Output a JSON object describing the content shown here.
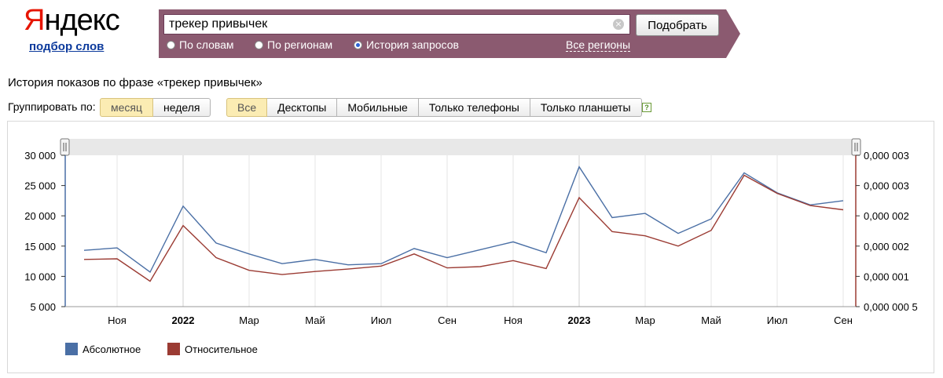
{
  "logo": {
    "text_first": "Я",
    "text_rest": "ндекс",
    "subtitle": "подбор слов"
  },
  "search": {
    "value": "трекер привычек",
    "clear_icon": "close-circle-icon",
    "submit_label": "Подобрать",
    "options": [
      {
        "label": "По словам",
        "selected": false
      },
      {
        "label": "По регионам",
        "selected": false
      },
      {
        "label": "История запросов",
        "selected": true
      }
    ],
    "regions_label": "Все регионы",
    "bar_color": "#8b5a70"
  },
  "page": {
    "title": "История показов по фразе «трекер привычек»",
    "group_label": "Группировать по:",
    "group_options": [
      {
        "label": "месяц",
        "active": true
      },
      {
        "label": "неделя",
        "active": false
      }
    ],
    "device_options": [
      {
        "label": "Все",
        "active": true
      },
      {
        "label": "Десктопы",
        "active": false
      },
      {
        "label": "Мобильные",
        "active": false
      },
      {
        "label": "Только телефоны",
        "active": false
      },
      {
        "label": "Только планшеты",
        "active": false
      }
    ],
    "help_icon": "question-icon"
  },
  "chart_data": {
    "type": "line",
    "title": "",
    "x": [
      "2021-10",
      "2021-11",
      "2021-12",
      "2022-01",
      "2022-02",
      "2022-03",
      "2022-04",
      "2022-05",
      "2022-06",
      "2022-07",
      "2022-08",
      "2022-09",
      "2022-10",
      "2022-11",
      "2022-12",
      "2023-01",
      "2023-02",
      "2023-03",
      "2023-04",
      "2023-05",
      "2023-06",
      "2023-07",
      "2023-08",
      "2023-09"
    ],
    "x_tick_labels": [
      {
        "month": "2021-11",
        "label": "Ноя",
        "bold": false
      },
      {
        "month": "2022-01",
        "label": "2022",
        "bold": true
      },
      {
        "month": "2022-03",
        "label": "Мар",
        "bold": false
      },
      {
        "month": "2022-05",
        "label": "Май",
        "bold": false
      },
      {
        "month": "2022-07",
        "label": "Июл",
        "bold": false
      },
      {
        "month": "2022-09",
        "label": "Сен",
        "bold": false
      },
      {
        "month": "2022-11",
        "label": "Ноя",
        "bold": false
      },
      {
        "month": "2023-01",
        "label": "2023",
        "bold": true
      },
      {
        "month": "2023-03",
        "label": "Мар",
        "bold": false
      },
      {
        "month": "2023-05",
        "label": "Май",
        "bold": false
      },
      {
        "month": "2023-07",
        "label": "Июл",
        "bold": false
      },
      {
        "month": "2023-09",
        "label": "Сен",
        "bold": false
      }
    ],
    "y_left": {
      "min": 5000,
      "max": 30000,
      "ticks": [
        "5 000",
        "10 000",
        "15 000",
        "20 000",
        "25 000",
        "30 000"
      ],
      "tick_values": [
        5000,
        10000,
        15000,
        20000,
        25000,
        30000
      ]
    },
    "y_right": {
      "min": 5e-07,
      "max": 3e-06,
      "ticks": [
        "0,000 000 5",
        "0,000 001",
        "0,000 002",
        "0,000 002",
        "0,000 003",
        "0,000 003"
      ],
      "tick_values": [
        5e-07,
        1e-06,
        1.5e-06,
        2e-06,
        2.5e-06,
        3e-06
      ]
    },
    "series": [
      {
        "name": "Абсолютное",
        "axis": "left",
        "color": "#4a6fa5",
        "values": [
          14300,
          14700,
          10700,
          21600,
          15500,
          13700,
          12100,
          12800,
          11900,
          12100,
          14600,
          13100,
          14400,
          15700,
          13900,
          28100,
          19700,
          20400,
          17100,
          19500,
          27100,
          23800,
          21800,
          22500
        ]
      },
      {
        "name": "Относительное",
        "axis": "right",
        "color": "#9b3b33",
        "values": [
          1.28e-06,
          1.29e-06,
          9.2e-07,
          1.84e-06,
          1.31e-06,
          1.1e-06,
          1.03e-06,
          1.08e-06,
          1.12e-06,
          1.17e-06,
          1.37e-06,
          1.14e-06,
          1.16e-06,
          1.26e-06,
          1.13e-06,
          2.3e-06,
          1.74e-06,
          1.67e-06,
          1.5e-06,
          1.76e-06,
          2.67e-06,
          2.37e-06,
          2.17e-06,
          2.1e-06
        ]
      }
    ],
    "grid": true,
    "legend_position": "bottom-left"
  }
}
